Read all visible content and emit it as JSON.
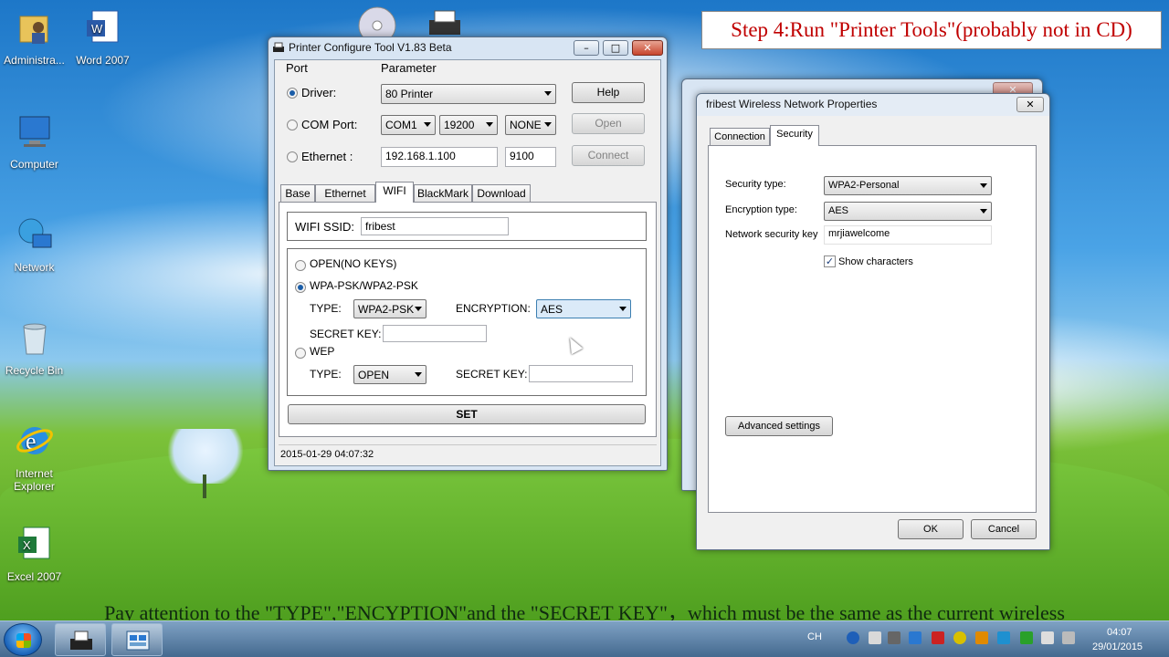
{
  "desktop": {
    "icons": [
      {
        "label": "Administra...",
        "icon": "user-folder-icon"
      },
      {
        "label": "Word 2007",
        "icon": "word-icon"
      },
      {
        "label": "Computer",
        "icon": "computer-icon"
      },
      {
        "label": "Network",
        "icon": "network-icon"
      },
      {
        "label": "Recycle Bin",
        "icon": "recycle-bin-icon"
      },
      {
        "label": "Internet Explorer",
        "icon": "ie-icon"
      },
      {
        "label": "Excel 2007",
        "icon": "excel-icon"
      }
    ]
  },
  "captions": {
    "step": "Step 4:Run \"Printer Tools\"(probably not in CD)",
    "bottom": "Pay attention to the \"TYPE\",\"ENCYPTION\"and the \"SECRET KEY\"，which must be the same as the current wireless"
  },
  "printer_tool": {
    "title": "Printer Configure Tool  V1.83  Beta",
    "port_label": "Port",
    "parameter_label": "Parameter",
    "driver_label": "Driver:",
    "driver_value": "80 Printer",
    "com_label": "COM Port:",
    "com_value": "COM1",
    "baud_value": "19200",
    "parity_value": "NONE",
    "ethernet_label": "Ethernet :",
    "ip_value": "192.168.1.100",
    "port_value": "9100",
    "help_button": "Help",
    "open_button": "Open",
    "connect_button": "Connect",
    "tabs": [
      "Base",
      "Ethernet",
      "WIFI",
      "BlackMark",
      "Download"
    ],
    "active_tab": "WIFI",
    "ssid_label": "WIFI SSID:",
    "ssid_value": "fribest",
    "open_no_keys": "OPEN(NO KEYS)",
    "wpa_label": "WPA-PSK/WPA2-PSK",
    "type_label": "TYPE:",
    "wpa_type_value": "WPA2-PSK",
    "encryption_label": "ENCRYPTION:",
    "encryption_value": "AES",
    "secret_key_label": "SECRET KEY:",
    "wep_label": "WEP",
    "wep_type_value": "OPEN",
    "set_button": "SET",
    "status": "2015-01-29 04:07:32"
  },
  "wireless_props": {
    "title": "fribest Wireless Network Properties",
    "tabs": [
      "Connection",
      "Security"
    ],
    "active_tab": "Security",
    "security_type_label": "Security type:",
    "security_type_value": "WPA2-Personal",
    "encryption_type_label": "Encryption type:",
    "encryption_type_value": "AES",
    "key_label": "Network security key",
    "key_value": "mrjiawelcome",
    "show_chars_label": "Show characters",
    "show_chars_checked": true,
    "advanced_button": "Advanced settings",
    "ok_button": "OK",
    "cancel_button": "Cancel"
  },
  "taskbar": {
    "lang": "CH",
    "time": "04:07",
    "date": "29/01/2015"
  },
  "colors": {
    "caption_red": "#c00000",
    "window_frame": "#d8e5f3"
  }
}
